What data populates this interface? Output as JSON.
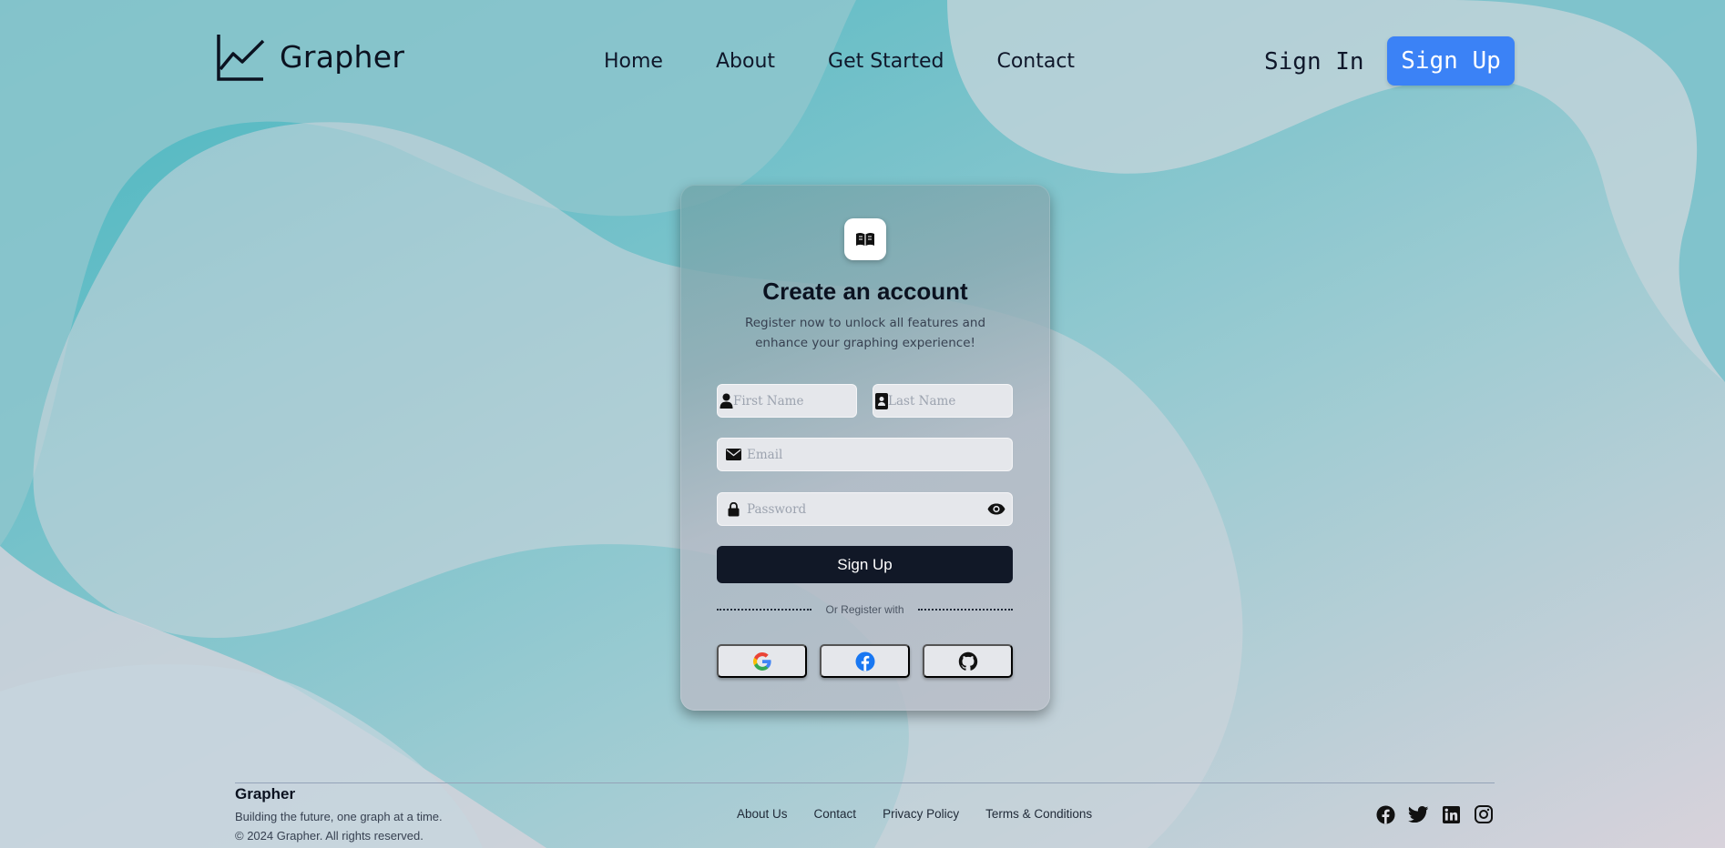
{
  "header": {
    "brand": "Grapher",
    "nav": [
      "Home",
      "About",
      "Get Started",
      "Contact"
    ],
    "sign_in": "Sign In",
    "sign_up": "Sign Up"
  },
  "card": {
    "title": "Create an account",
    "subtitle": "Register now to unlock all features and enhance your graphing experience!",
    "first_name_placeholder": "First Name",
    "last_name_placeholder": "Last Name",
    "email_placeholder": "Email",
    "password_placeholder": "Password",
    "submit": "Sign Up",
    "divider": "Or Register with",
    "providers": [
      "google",
      "facebook",
      "github"
    ]
  },
  "footer": {
    "brand": "Grapher",
    "tagline": "Building the future, one graph at a time.",
    "copyright": "© 2024 Grapher. All rights reserved.",
    "links": [
      "About Us",
      "Contact",
      "Privacy Policy",
      "Terms & Conditions"
    ],
    "socials": [
      "facebook",
      "twitter",
      "linkedin",
      "instagram"
    ]
  },
  "colors": {
    "accent": "#3b82f6",
    "submit_bg": "#111827",
    "background_teal": "#4fb8c2",
    "background_pink": "#dcd3dc"
  }
}
